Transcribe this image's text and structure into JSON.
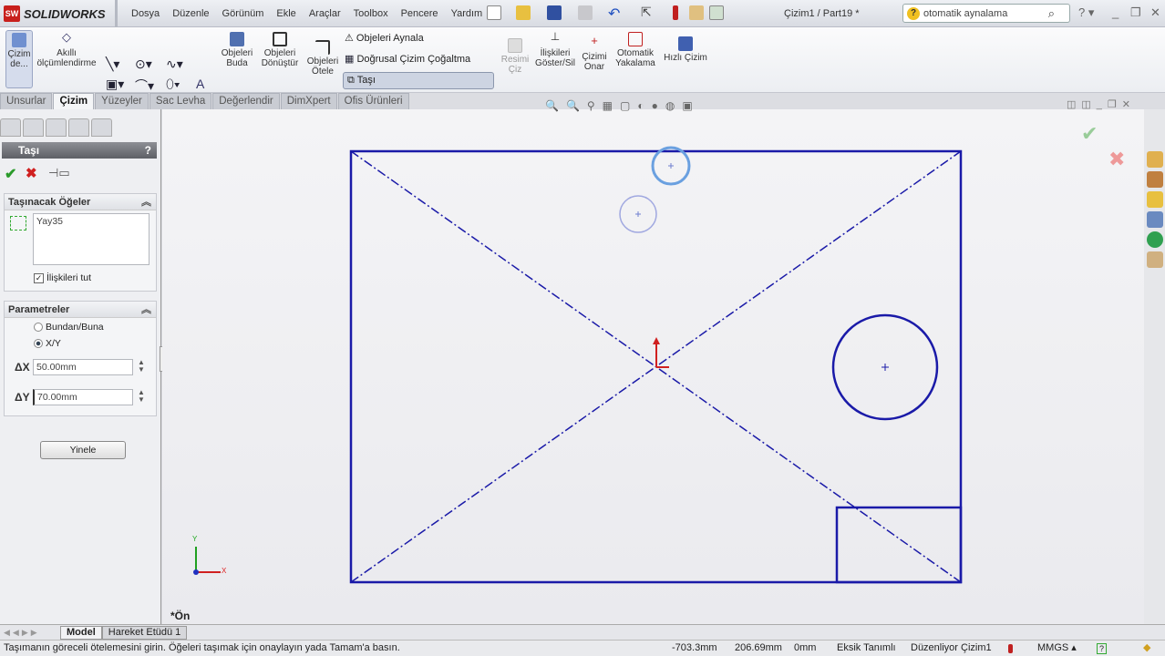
{
  "app": {
    "name": "SOLIDWORKS",
    "document_title": "Çizim1 / Part19 *"
  },
  "menu": [
    "Dosya",
    "Düzenle",
    "Görünüm",
    "Ekle",
    "Araçlar",
    "Toolbox",
    "Pencere",
    "Yardım"
  ],
  "search": {
    "value": "otomatik aynalama"
  },
  "ribbon": {
    "sketch": "Çizim de...",
    "smart_dim": "Akıllı ölçümlendirme",
    "trim": "Objeleri Buda",
    "convert": "Objeleri Dönüştür",
    "offset": "Objeleri Ötele",
    "mirror": "Objeleri Aynala",
    "linear_pattern": "Doğrusal Çizim Çoğaltma",
    "move": "Taşı",
    "picture": "Resimi Çiz",
    "relations": "İlişkileri Göster/Sil",
    "repair": "Çizimi Onar",
    "quick_snaps": "Otomatik Yakalama",
    "rapid_sketch": "Hızlı Çizim"
  },
  "tabs": [
    "Unsurlar",
    "Çizim",
    "Yüzeyler",
    "Sac Levha",
    "Değerlendir",
    "DimXpert",
    "Ofis Ürünleri"
  ],
  "property_manager": {
    "title": "Taşı",
    "help": "?",
    "entities_group": {
      "title": "Taşınacak Öğeler",
      "items": [
        "Yay35"
      ],
      "keep_relations_label": "İlişkileri tut",
      "keep_relations": true
    },
    "params_group": {
      "title": "Parametreler",
      "option1": "Bundan/Buna",
      "option2": "X/Y",
      "selected": "X/Y",
      "dx_label": "ΔX",
      "dx": "50.00mm",
      "dy_label": "ΔY",
      "dy": "70.00mm"
    },
    "repeat_button": "Yinele"
  },
  "canvas": {
    "view_label": "*Ön",
    "axis_x": "X",
    "axis_y": "Y"
  },
  "bottom_tabs": [
    "Model",
    "Hareket Etüdü 1"
  ],
  "status": {
    "message": "Taşımanın göreceli ötelemesini girin. Öğeleri taşımak için onaylayın yada Tamam'a basın.",
    "x": "-703.3mm",
    "y": "206.69mm",
    "z": "0mm",
    "state": "Eksik Tanımlı",
    "mode": "Düzenliyor Çizim1",
    "units": "MMGS"
  },
  "colors": {
    "sketch": "#1a1aa8",
    "preview": "#6a8fd8"
  }
}
